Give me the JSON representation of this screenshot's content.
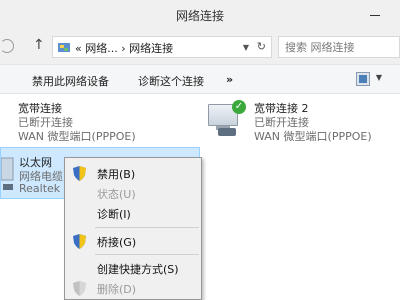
{
  "window": {
    "title": "网络连接"
  },
  "address": {
    "path": "« 网络... › 网络连接",
    "search_placeholder": "搜索 网络连接"
  },
  "commands": [
    "禁用此网络设备",
    "诊断这个连接",
    "»"
  ],
  "connections": [
    {
      "name": "宽带连接",
      "status": "已断开连接",
      "device": "WAN 微型端口(PPPOE)"
    },
    {
      "name": "宽带连接 2",
      "status": "已断开连接",
      "device": "WAN 微型端口(PPPOE)"
    },
    {
      "name": "以太网",
      "status": "网络电缆",
      "device": "Realtek"
    }
  ],
  "context_menu": [
    {
      "label": "禁用(B)",
      "shield": true,
      "disabled": false,
      "bold": false
    },
    {
      "label": "状态(U)",
      "shield": false,
      "disabled": true,
      "bold": false
    },
    {
      "label": "诊断(I)",
      "shield": false,
      "disabled": false,
      "bold": false
    },
    {
      "label": "桥接(G)",
      "shield": true,
      "disabled": false,
      "bold": false
    },
    {
      "label": "创建快捷方式(S)",
      "shield": false,
      "disabled": false,
      "bold": false
    },
    {
      "label": "删除(D)",
      "shield": true,
      "disabled": true,
      "bold": false
    }
  ]
}
